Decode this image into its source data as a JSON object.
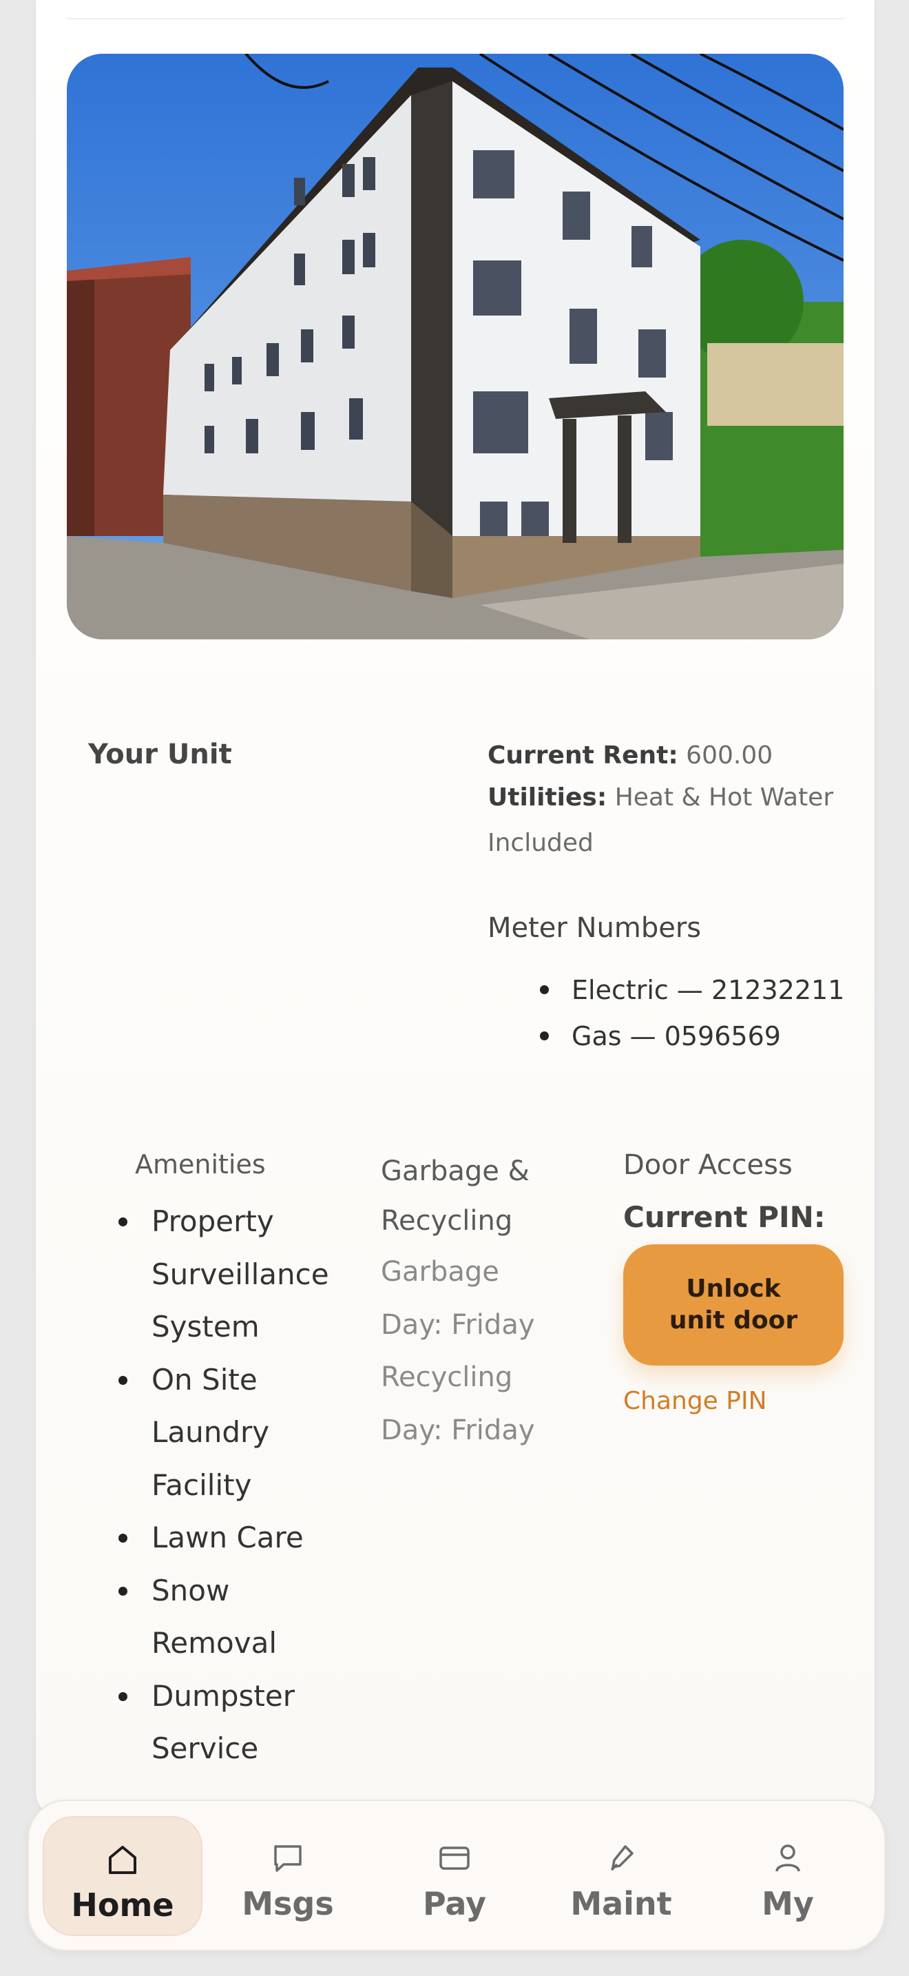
{
  "unit": {
    "heading": "Your Unit",
    "rent_label": "Current Rent:",
    "rent_value": "600.00",
    "utilities_label": "Utilities:",
    "utilities_value": "Heat & Hot Water Included",
    "meter_heading": "Meter Numbers",
    "meters": [
      "Electric — 21232211",
      "Gas — 0596569"
    ]
  },
  "amenities": {
    "heading": "Amenities",
    "items": [
      "Property Surveillance System",
      "On Site Laundry Facility",
      "Lawn Care",
      "Snow Removal",
      "Dumpster Service"
    ]
  },
  "garbage": {
    "heading": "Garbage & Recycling",
    "garbage_day": "Garbage Day: Friday",
    "recycling_day": "Recycling Day: Friday"
  },
  "door": {
    "heading": "Door Access",
    "pin_label": "Current PIN:",
    "unlock_label": "Unlock\nunit door",
    "change_pin": "Change PIN"
  },
  "nav": {
    "items": [
      {
        "label": "Home",
        "icon": "home-icon",
        "active": true
      },
      {
        "label": "Msgs",
        "icon": "message-icon",
        "active": false
      },
      {
        "label": "Pay",
        "icon": "card-icon",
        "active": false
      },
      {
        "label": "Maint",
        "icon": "wrench-icon",
        "active": false
      },
      {
        "label": "My",
        "icon": "person-icon",
        "active": false
      }
    ]
  },
  "colors": {
    "accent": "#e89a40",
    "link": "#d27d22",
    "nav_active_bg": "#f5e6da"
  }
}
